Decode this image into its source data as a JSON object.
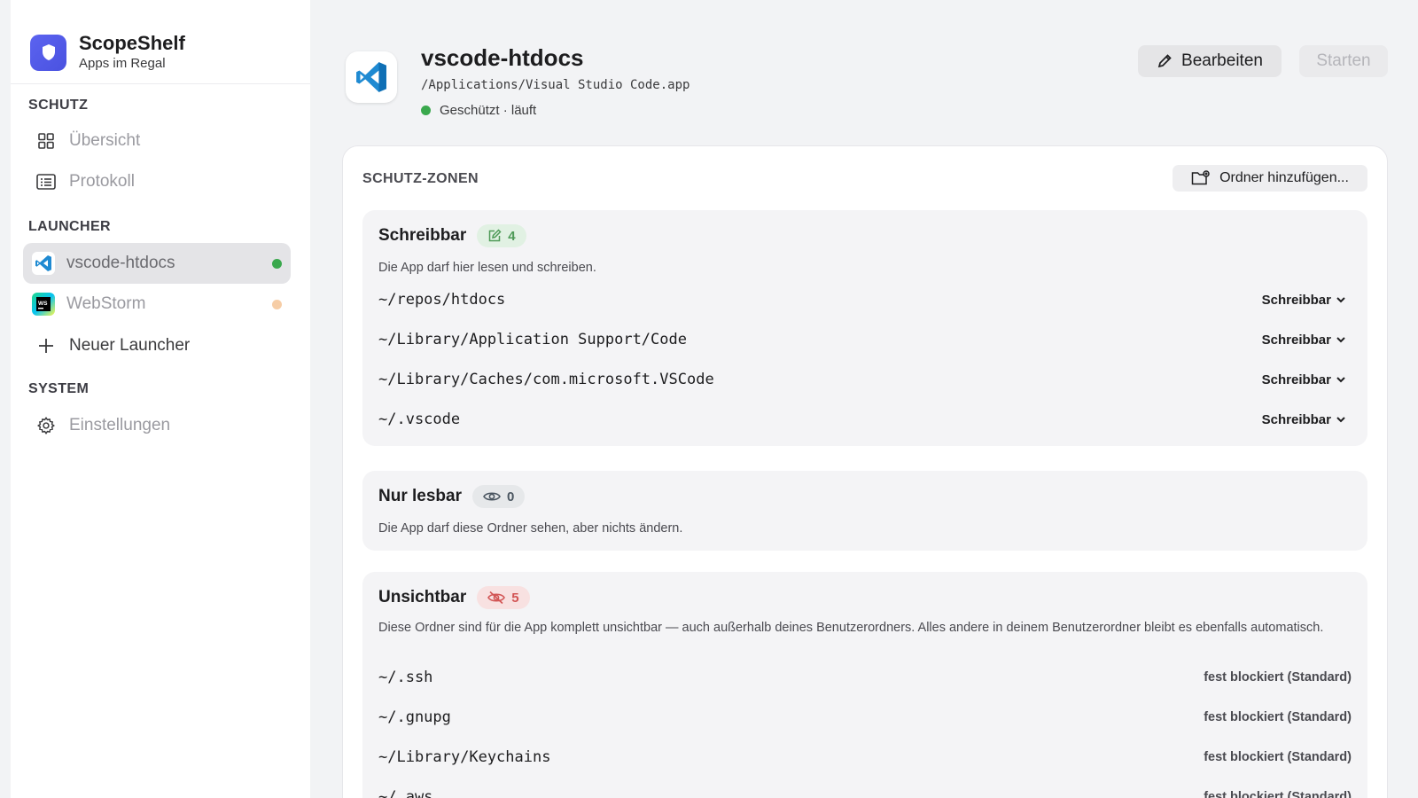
{
  "brand": {
    "title": "ScopeShelf",
    "subtitle": "Apps im Regal"
  },
  "sidebar": {
    "sections": [
      {
        "label": "SCHUTZ"
      },
      {
        "label": "LAUNCHER"
      },
      {
        "label": "SYSTEM"
      }
    ],
    "schutz_items": [
      {
        "label": "Übersicht",
        "icon": "grid-icon"
      },
      {
        "label": "Protokoll",
        "icon": "list-icon"
      }
    ],
    "launchers": [
      {
        "label": "vscode-htdocs",
        "icon": "vscode-icon",
        "status_color": "#3aa84d",
        "active": true
      },
      {
        "label": "WebStorm",
        "icon": "webstorm-icon",
        "status_color": "#f6cda6",
        "active": false
      }
    ],
    "new_launcher": {
      "label": "Neuer Launcher",
      "icon": "plus-icon"
    },
    "system_items": [
      {
        "label": "Einstellungen",
        "icon": "gear-icon"
      }
    ]
  },
  "header": {
    "title": "vscode-htdocs",
    "path": "/Applications/Visual Studio Code.app",
    "status": "Geschützt · läuft",
    "status_color": "#3aa84d",
    "edit_label": "Bearbeiten",
    "start_label": "Starten"
  },
  "zones_card": {
    "title": "SCHUTZ-ZONEN",
    "add_label": "Ordner hinzufügen...",
    "writable": {
      "title": "Schreibbar",
      "count": "4",
      "description": "Die App darf hier lesen und schreiben.",
      "rows": [
        {
          "path": "~/repos/htdocs",
          "mode": "Schreibbar"
        },
        {
          "path": "~/Library/Application Support/Code",
          "mode": "Schreibbar"
        },
        {
          "path": "~/Library/Caches/com.microsoft.VSCode",
          "mode": "Schreibbar"
        },
        {
          "path": "~/.vscode",
          "mode": "Schreibbar"
        }
      ]
    },
    "readonly": {
      "title": "Nur lesbar",
      "count": "0",
      "description": "Die App darf diese Ordner sehen, aber nichts ändern."
    },
    "hidden": {
      "title": "Unsichtbar",
      "count": "5",
      "description": "Diese Ordner sind für die App komplett unsichtbar — auch außerhalb deines Benutzerordners. Alles andere in deinem Benutzerordner bleibt es ebenfalls automatisch.",
      "rows": [
        {
          "path": "~/.ssh",
          "mode": "fest blockiert (Standard)"
        },
        {
          "path": "~/.gnupg",
          "mode": "fest blockiert (Standard)"
        },
        {
          "path": "~/Library/Keychains",
          "mode": "fest blockiert (Standard)"
        },
        {
          "path": "~/.aws",
          "mode": "fest blockiert (Standard)"
        }
      ]
    }
  },
  "colors": {
    "accent": "#4f57e8",
    "green": "#3aa84d",
    "red": "#d25555"
  }
}
